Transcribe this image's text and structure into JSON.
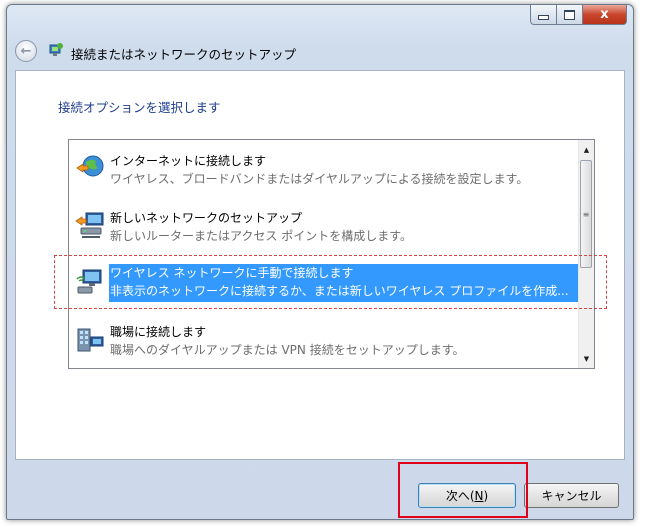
{
  "window": {
    "title": "接続またはネットワークのセットアップ",
    "close_glyph": "x",
    "back_glyph": "←"
  },
  "content": {
    "heading": "接続オプションを選択します"
  },
  "options": [
    {
      "title": "インターネットに接続します",
      "desc": "ワイヤレス、ブロードバンドまたはダイヤルアップによる接続を設定します。",
      "icon": "globe-network-icon",
      "selected": false
    },
    {
      "title": "新しいネットワークのセットアップ",
      "desc": "新しいルーターまたはアクセス ポイントを構成します。",
      "icon": "router-setup-icon",
      "selected": false
    },
    {
      "title": "ワイヤレス ネットワークに手動で接続します",
      "desc": "非表示のネットワークに接続するか、または新しいワイヤレス プロファイルを作成...",
      "icon": "wireless-network-icon",
      "selected": true
    },
    {
      "title": "職場に接続します",
      "desc": "職場へのダイヤルアップまたは VPN 接続をセットアップします。",
      "icon": "workplace-vpn-icon",
      "selected": false
    }
  ],
  "scrollbar": {
    "up_glyph": "▲",
    "down_glyph": "▼",
    "thumb_glyph": "≡"
  },
  "buttons": {
    "next_prefix": "次へ(",
    "next_key": "N",
    "next_suffix": ")",
    "cancel": "キャンセル"
  },
  "colors": {
    "selection": "#3399ff",
    "heading": "#1e3d8f",
    "annotation_red": "#e0001b"
  }
}
